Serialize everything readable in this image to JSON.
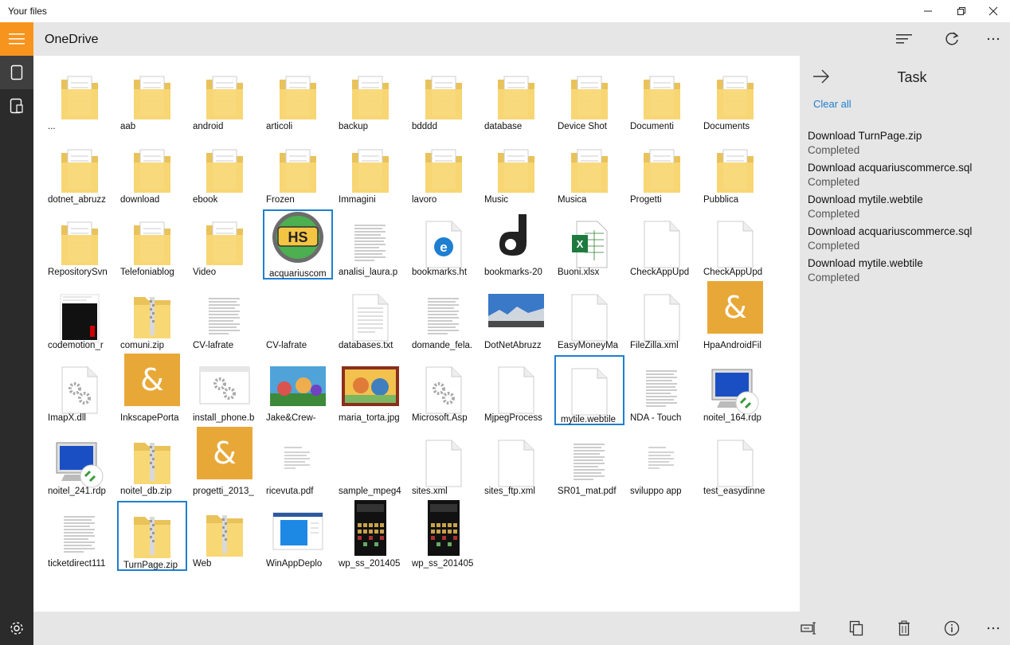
{
  "window": {
    "title": "Your files"
  },
  "topbar": {
    "location": "OneDrive"
  },
  "colors": {
    "accent": "#f7941d",
    "selection": "#1e7fd0",
    "folder": "#f8d775",
    "panel": "#e6e6e6"
  },
  "files": [
    {
      "label": "...",
      "type": "folder"
    },
    {
      "label": "aab",
      "type": "folder"
    },
    {
      "label": "android",
      "type": "folder"
    },
    {
      "label": "articoli",
      "type": "folder"
    },
    {
      "label": "backup",
      "type": "folder"
    },
    {
      "label": "bdddd",
      "type": "folder"
    },
    {
      "label": "database",
      "type": "folder"
    },
    {
      "label": "Device Shot",
      "type": "folder"
    },
    {
      "label": "Documenti",
      "type": "folder"
    },
    {
      "label": "Documents",
      "type": "folder"
    },
    {
      "label": "dotnet_abruzz",
      "type": "folder"
    },
    {
      "label": "download",
      "type": "folder"
    },
    {
      "label": "ebook",
      "type": "folder"
    },
    {
      "label": "Frozen",
      "type": "folder"
    },
    {
      "label": "Immagini",
      "type": "folder"
    },
    {
      "label": "lavoro",
      "type": "folder"
    },
    {
      "label": "Music",
      "type": "folder"
    },
    {
      "label": "Musica",
      "type": "folder"
    },
    {
      "label": "Progetti",
      "type": "folder"
    },
    {
      "label": "Pubblica",
      "type": "folder"
    },
    {
      "label": "RepositorySvn",
      "type": "folder"
    },
    {
      "label": "Telefoniablog",
      "type": "folder"
    },
    {
      "label": "Video",
      "type": "folder"
    },
    {
      "label": "acquariuscom",
      "type": "hs",
      "selected": true
    },
    {
      "label": "analisi_laura.p",
      "type": "docthumb"
    },
    {
      "label": "bookmarks.ht",
      "type": "edge"
    },
    {
      "label": "bookmarks-20",
      "type": "json"
    },
    {
      "label": "Buoni.xlsx",
      "type": "excel"
    },
    {
      "label": "CheckAppUpd",
      "type": "blank"
    },
    {
      "label": "CheckAppUpd",
      "type": "blank"
    },
    {
      "label": "codemotion_r",
      "type": "darkdoc"
    },
    {
      "label": "comuni.zip",
      "type": "zip"
    },
    {
      "label": "CV-lafrate",
      "type": "docthumb"
    },
    {
      "label": "CV-lafrate",
      "type": "none"
    },
    {
      "label": "databases.txt",
      "type": "textdoc"
    },
    {
      "label": "domande_fela.",
      "type": "docthumb"
    },
    {
      "label": "DotNetAbruzz",
      "type": "photo-sky"
    },
    {
      "label": "EasyMoneyMa",
      "type": "blank"
    },
    {
      "label": "FileZilla.xml",
      "type": "blank"
    },
    {
      "label": "HpaAndroidFil",
      "type": "amp"
    },
    {
      "label": "ImapX.dll",
      "type": "gear"
    },
    {
      "label": "InkscapePorta",
      "type": "amp"
    },
    {
      "label": "install_phone.b",
      "type": "gearwin"
    },
    {
      "label": "Jake&Crew-",
      "type": "photo-cartoon"
    },
    {
      "label": "maria_torta.jpg",
      "type": "photo-cartoon2"
    },
    {
      "label": "Microsoft.Asp",
      "type": "gear"
    },
    {
      "label": "MjpegProcess",
      "type": "blank"
    },
    {
      "label": "mytile.webtile",
      "type": "blank",
      "selected": true
    },
    {
      "label": "NDA - Touch",
      "type": "docthumb"
    },
    {
      "label": "noitel_164.rdp",
      "type": "rdp"
    },
    {
      "label": "noitel_241.rdp",
      "type": "rdp"
    },
    {
      "label": "noitel_db.zip",
      "type": "zip"
    },
    {
      "label": "progetti_2013_",
      "type": "amp"
    },
    {
      "label": "ricevuta.pdf",
      "type": "docsmall"
    },
    {
      "label": "sample_mpeg4",
      "type": "none"
    },
    {
      "label": "sites.xml",
      "type": "blank"
    },
    {
      "label": "sites_ftp.xml",
      "type": "blank"
    },
    {
      "label": "SR01_mat.pdf",
      "type": "docthumb"
    },
    {
      "label": "sviluppo app",
      "type": "docsmall"
    },
    {
      "label": "test_easydinne",
      "type": "blank"
    },
    {
      "label": "ticketdirect111",
      "type": "docthumb"
    },
    {
      "label": "TurnPage.zip",
      "type": "zip",
      "selected": true
    },
    {
      "label": "Web",
      "type": "zip"
    },
    {
      "label": "WinAppDeplo",
      "type": "winapp"
    },
    {
      "label": "wp_ss_201405",
      "type": "phone"
    },
    {
      "label": "wp_ss_201405",
      "type": "phone"
    }
  ],
  "task_panel": {
    "title": "Task",
    "clear_all": "Clear all",
    "items": [
      {
        "name": "Download TurnPage.zip",
        "status": "Completed"
      },
      {
        "name": "Download acquariuscommerce.sql",
        "status": "Completed"
      },
      {
        "name": "Download mytile.webtile",
        "status": "Completed"
      },
      {
        "name": "Download acquariuscommerce.sql",
        "status": "Completed"
      },
      {
        "name": "Download mytile.webtile",
        "status": "Completed"
      }
    ]
  }
}
